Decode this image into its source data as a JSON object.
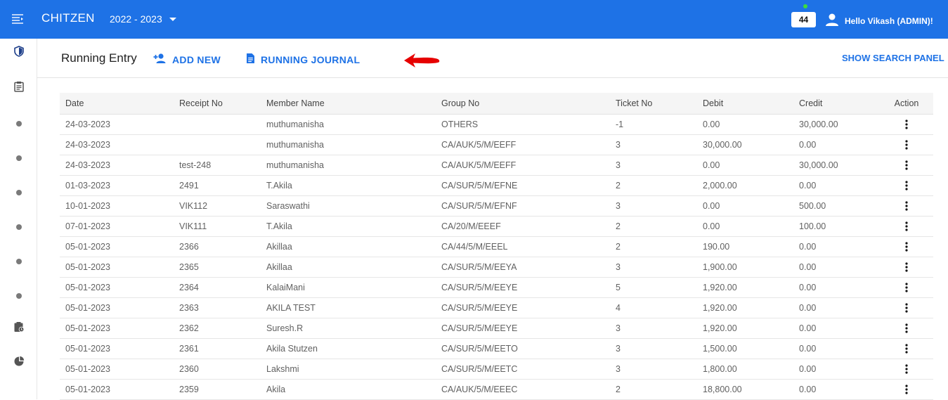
{
  "app": {
    "brand": "CHITZEN",
    "year": "2022 - 2023",
    "notification_count": "44",
    "user_greeting": "Hello Vikash (ADMIN)!"
  },
  "colors": {
    "primary": "#1e72e6",
    "annotation_arrow": "#e60000"
  },
  "page": {
    "title": "Running Entry",
    "add_new": "ADD NEW",
    "running_journal": "RUNNING JOURNAL",
    "search_panel": "SHOW SEARCH PANEL"
  },
  "sidebar_icons": [
    "shield-icon",
    "clipboard-icon",
    "dot-icon",
    "dot-icon",
    "dot-icon",
    "dot-icon",
    "dot-icon",
    "dot-icon",
    "pending-actions-icon",
    "pie-chart-icon"
  ],
  "table": {
    "headers": [
      "Date",
      "Receipt No",
      "Member Name",
      "Group No",
      "Ticket No",
      "Debit",
      "Credit",
      "Action"
    ],
    "rows": [
      [
        "24-03-2023",
        "",
        "muthumanisha",
        "OTHERS",
        "-1",
        "0.00",
        "30,000.00"
      ],
      [
        "24-03-2023",
        "",
        "muthumanisha",
        "CA/AUK/5/M/EEFF",
        "3",
        "30,000.00",
        "0.00"
      ],
      [
        "24-03-2023",
        "test-248",
        "muthumanisha",
        "CA/AUK/5/M/EEFF",
        "3",
        "0.00",
        "30,000.00"
      ],
      [
        "01-03-2023",
        "2491",
        "T.Akila",
        "CA/SUR/5/M/EFNE",
        "2",
        "2,000.00",
        "0.00"
      ],
      [
        "10-01-2023",
        "VIK112",
        "Saraswathi",
        "CA/SUR/5/M/EFNF",
        "3",
        "0.00",
        "500.00"
      ],
      [
        "07-01-2023",
        "VIK111",
        "T.Akila",
        "CA/20/M/EEEF",
        "2",
        "0.00",
        "100.00"
      ],
      [
        "05-01-2023",
        "2366",
        "Akillaa",
        "CA/44/5/M/EEEL",
        "2",
        "190.00",
        "0.00"
      ],
      [
        "05-01-2023",
        "2365",
        "Akillaa",
        "CA/SUR/5/M/EEYA",
        "3",
        "1,900.00",
        "0.00"
      ],
      [
        "05-01-2023",
        "2364",
        "KalaiMani",
        "CA/SUR/5/M/EEYE",
        "5",
        "1,920.00",
        "0.00"
      ],
      [
        "05-01-2023",
        "2363",
        "AKILA TEST",
        "CA/SUR/5/M/EEYE",
        "4",
        "1,920.00",
        "0.00"
      ],
      [
        "05-01-2023",
        "2362",
        "Suresh.R",
        "CA/SUR/5/M/EEYE",
        "3",
        "1,920.00",
        "0.00"
      ],
      [
        "05-01-2023",
        "2361",
        "Akila Stutzen",
        "CA/SUR/5/M/EETO",
        "3",
        "1,500.00",
        "0.00"
      ],
      [
        "05-01-2023",
        "2360",
        "Lakshmi",
        "CA/SUR/5/M/EETC",
        "3",
        "1,800.00",
        "0.00"
      ],
      [
        "05-01-2023",
        "2359",
        "Akila",
        "CA/AUK/5/M/EEEC",
        "2",
        "18,800.00",
        "0.00"
      ]
    ]
  }
}
